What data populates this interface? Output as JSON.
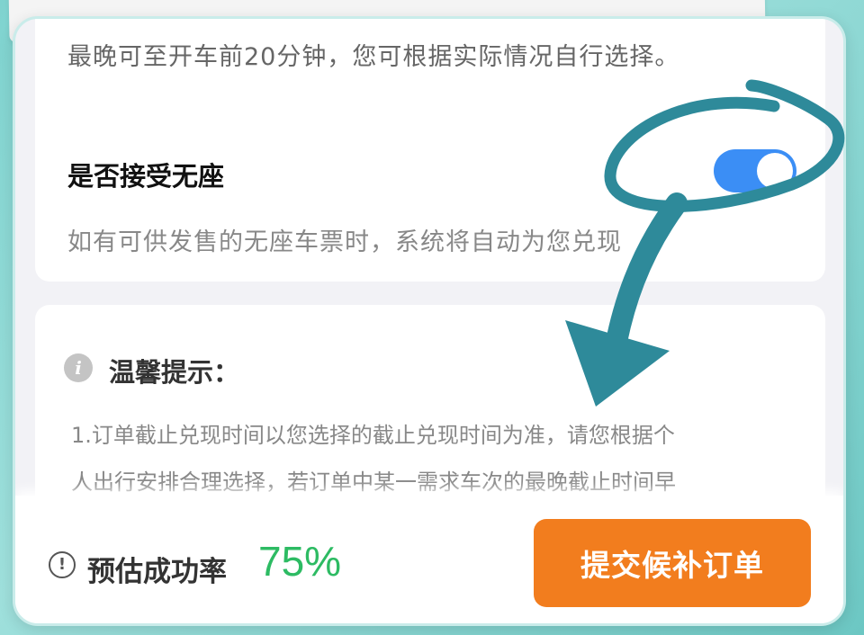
{
  "option_card": {
    "latest_time_desc": "最晚可至开车前20分钟，您可根据实际情况自行选择。",
    "no_seat_title": "是否接受无座",
    "no_seat_toggle_on": true,
    "no_seat_desc": "如有可供发售的无座车票时，系统将自动为您兑现"
  },
  "tips_card": {
    "title": "温馨提示：",
    "lines": [
      "1.订单截止兑现时间以您选择的截止兑现时间为准，请您根据个",
      "人出行安排合理选择，若订单中某一需求车次的最晚截止时间早"
    ]
  },
  "bottom_bar": {
    "rate_label": "预估成功率",
    "rate_value": "75%",
    "submit_label": "提交候补订单"
  },
  "colors": {
    "toggle_on": "#3b8ef5",
    "submit": "#f27d1e",
    "rate": "#2dbb63",
    "annotation": "#2e8a9a"
  },
  "icons": {
    "tip": "info-circle-icon",
    "rate_info": "exclamation-circle-icon"
  }
}
